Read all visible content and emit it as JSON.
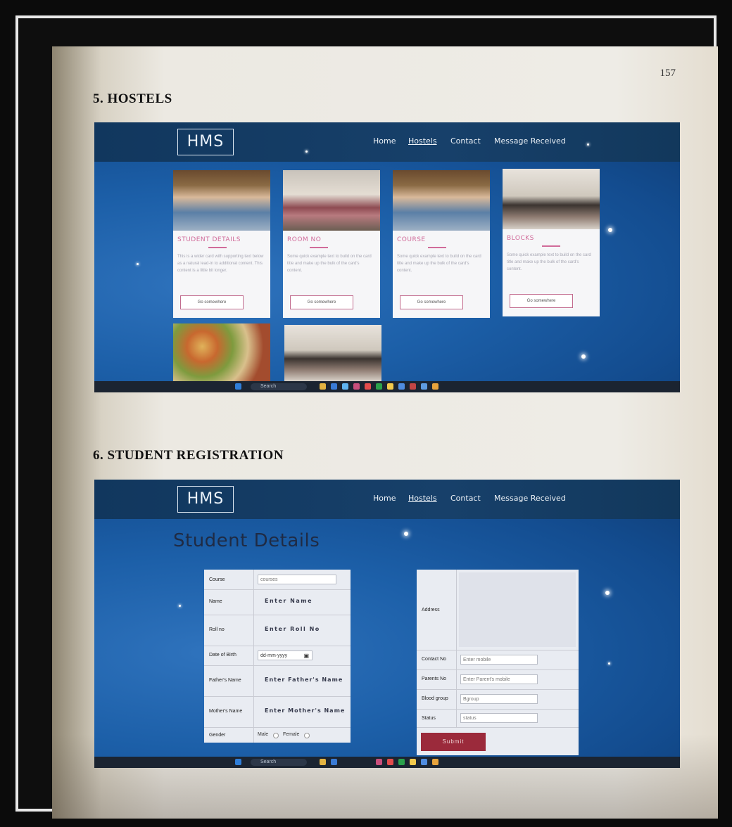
{
  "page": {
    "number": "157",
    "section5_heading": "5. HOSTELS",
    "section6_heading": "6. STUDENT REGISTRATION"
  },
  "nav": {
    "logo": "HMS",
    "links": [
      "Home",
      "Hostels",
      "Contact",
      "Message Received"
    ]
  },
  "hostels": {
    "cards": [
      {
        "title": "STUDENT DETAILS",
        "text": "This is a wider card with supporting text below as a natural lead-in to additional content. This content is a little bit longer.",
        "button": "Go somewhere"
      },
      {
        "title": "ROOM NO",
        "text": "Some quick example text to build on the card title and make up the bulk of the card's content.",
        "button": "Go somewhere"
      },
      {
        "title": "COURSE",
        "text": "Some quick example text to build on the card title and make up the bulk of the card's content.",
        "button": "Go somewhere"
      },
      {
        "title": "BLOCKS",
        "text": "Some quick example text to build on the card title and make up the bulk of the card's content.",
        "button": "Go somewhere"
      }
    ],
    "taskbar_search": "Search"
  },
  "registration": {
    "title": "Student Details",
    "left_fields": [
      {
        "label": "Course",
        "value": "courses"
      },
      {
        "label": "Name",
        "value": "Enter Name"
      },
      {
        "label": "Roll no",
        "value": "Enter Roll No"
      },
      {
        "label": "Date of Birth",
        "value": "dd-mm-yyyy"
      },
      {
        "label": "Father's Name",
        "value": "Enter Father's Name"
      },
      {
        "label": "Mother's Name",
        "value": "Enter Mother's Name"
      },
      {
        "label": "Gender",
        "value": "Male",
        "value2": "Female"
      }
    ],
    "right_fields": [
      {
        "label": "Address",
        "value": ""
      },
      {
        "label": "Contact No",
        "value": "Enter mobile"
      },
      {
        "label": "Parents No",
        "value": "Enter Parent's mobile"
      },
      {
        "label": "Blood group",
        "value": "Bgroup"
      },
      {
        "label": "Status",
        "value": "status"
      }
    ],
    "submit": "Submit",
    "taskbar_search": "Search"
  },
  "colors": {
    "navbar": "#17406a",
    "accent_pink": "#d16b9a",
    "submit": "#9b2a3b"
  }
}
